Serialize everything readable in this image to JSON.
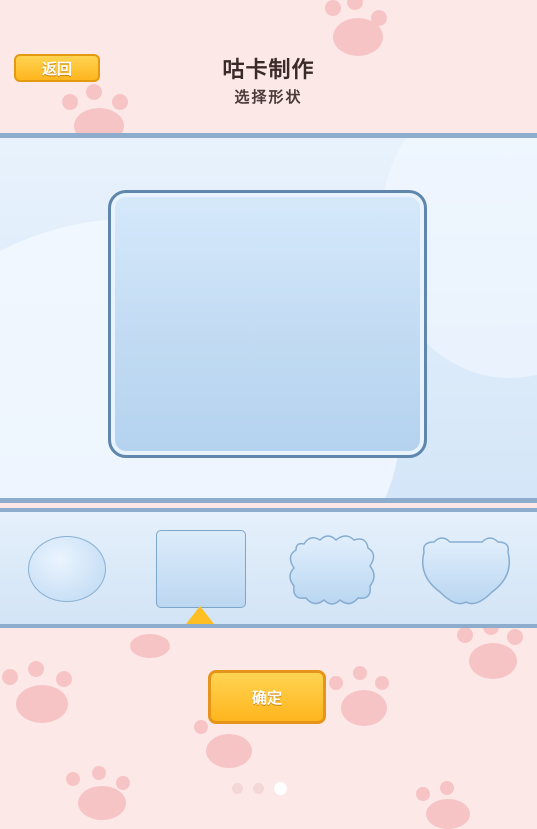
{
  "header": {
    "back_label": "返回",
    "title": "咕卡制作",
    "subtitle": "选择形状"
  },
  "shapes": {
    "items": [
      "circle",
      "square",
      "cloud",
      "bear"
    ],
    "selected": "square"
  },
  "footer": {
    "confirm_label": "确定",
    "page_count": 3,
    "current_page": 3
  },
  "colors": {
    "background": "#fde8e8",
    "paw": "#f7c4c6",
    "button": "#ffbf22",
    "panel_border": "#8eaccb"
  }
}
